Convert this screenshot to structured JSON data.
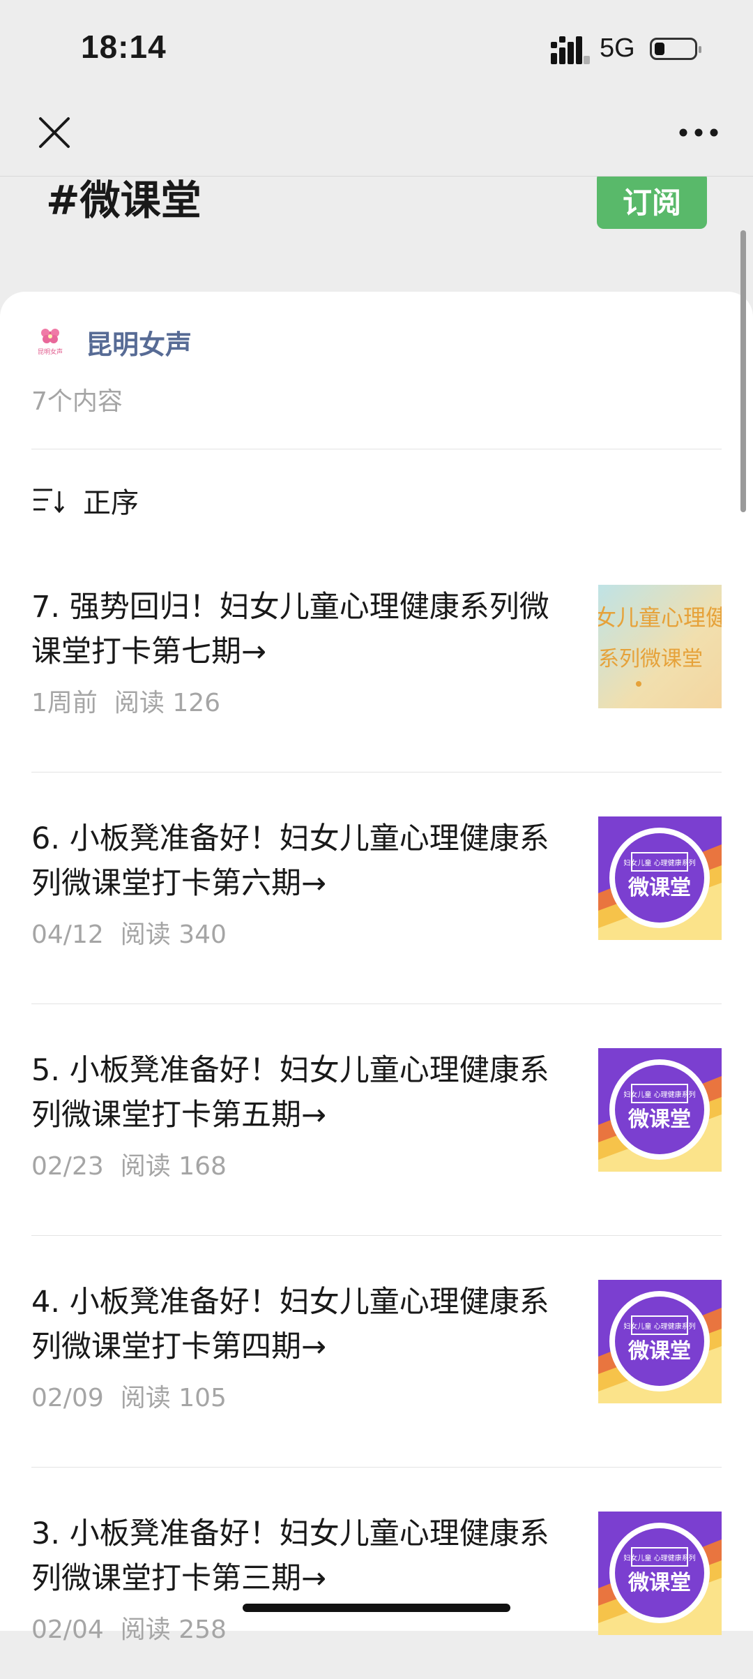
{
  "status_bar": {
    "time": "18:14",
    "network": "5G",
    "battery_level": 0.25,
    "signal_icon": "signal-icon",
    "battery_icon": "battery-icon"
  },
  "nav": {
    "close_icon": "close-icon",
    "more_icon": "more-icon"
  },
  "header": {
    "title": "#微课堂",
    "subscribe_label": "订阅",
    "subscribe_color": "#59b96a"
  },
  "account": {
    "name": "昆明女声",
    "avatar_caption": "昆明女声",
    "content_count": "7个内容"
  },
  "sort": {
    "label": "正序",
    "icon": "sort-icon"
  },
  "articles": [
    {
      "title": "7. 强势回归！妇女儿童心理健康系列微课堂打卡第七期→",
      "date": "1周前",
      "reads": "阅读 126",
      "thumb": {
        "style": "banner",
        "line1": "女儿童心理健",
        "line2": "系列微课堂"
      }
    },
    {
      "title": "6. 小板凳准备好！妇女儿童心理健康系列微课堂打卡第六期→",
      "date": "04/12",
      "reads": "阅读 340",
      "thumb": {
        "style": "badge",
        "small": "妇女儿童 心理健康系列",
        "big": "微课堂"
      }
    },
    {
      "title": "5. 小板凳准备好！妇女儿童心理健康系列微课堂打卡第五期→",
      "date": "02/23",
      "reads": "阅读 168",
      "thumb": {
        "style": "badge",
        "small": "妇女儿童 心理健康系列",
        "big": "微课堂"
      }
    },
    {
      "title": "4. 小板凳准备好！妇女儿童心理健康系列微课堂打卡第四期→",
      "date": "02/09",
      "reads": "阅读 105",
      "thumb": {
        "style": "badge",
        "small": "妇女儿童 心理健康系列",
        "big": "微课堂"
      }
    },
    {
      "title": "3. 小板凳准备好！妇女儿童心理健康系列微课堂打卡第三期→",
      "date": "02/04",
      "reads": "阅读 258",
      "thumb": {
        "style": "badge",
        "small": "妇女儿童 心理健康系列",
        "big": "微课堂"
      }
    }
  ]
}
